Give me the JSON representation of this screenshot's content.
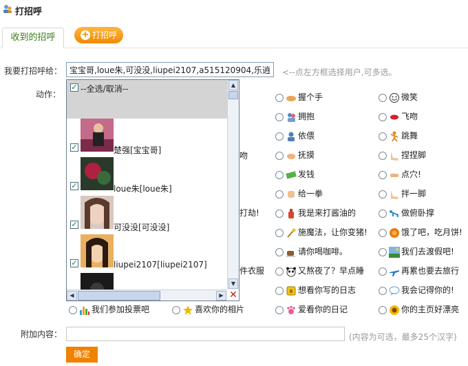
{
  "header": {
    "title": "打招呼"
  },
  "tabs": {
    "received": "收到的招呼",
    "greet_button": "打招呼"
  },
  "form": {
    "to_label": "我要打招呼给：",
    "to_value": "宝宝哥,loue朱,可没没,liupei2107,a515120904,乐逍",
    "to_hint": "<--点左方框选择用户,可多选。",
    "action_label": "动作：",
    "extra_label": "附加内容：",
    "extra_hint": "(内容为可选，最多25个汉字)",
    "submit": "确定"
  },
  "picker": {
    "select_all": "--全选/取消--",
    "users": [
      {
        "name": "楚强[宝宝哥]",
        "checked": true
      },
      {
        "name": "loue朱[loue朱]",
        "checked": true
      },
      {
        "name": "可没没[可没没]",
        "checked": true
      },
      {
        "name": "liupei2107[liupei2107]",
        "checked": true
      }
    ]
  },
  "actions": {
    "col2": [
      "握个手",
      "拥抱",
      "依偎",
      "抚摸",
      "发钱",
      "给一拳",
      "我是来打酱油的",
      "施魔法，让你变猪!",
      "请你喝咖啡。",
      "又熬夜了？早点睡",
      "想看你写的日志",
      "爱看你的日记"
    ],
    "col3": [
      "微笑",
      "飞吻",
      "跳舞",
      "捏捏脚",
      "点穴!",
      "拌一脚",
      "做俯卧撑",
      "饿了吧，吃月饼!",
      "我们去渡假吧!",
      "再累也要去旅行",
      "我会记得你的!",
      "你的主页好漂亮"
    ],
    "partial": [
      "吻",
      "打劫!",
      "件衣服"
    ],
    "bottom": [
      "我们参加投票吧",
      "喜欢你的相片"
    ]
  },
  "colors": {
    "accent": "#f08200",
    "tab_text": "#3a7b1a"
  }
}
